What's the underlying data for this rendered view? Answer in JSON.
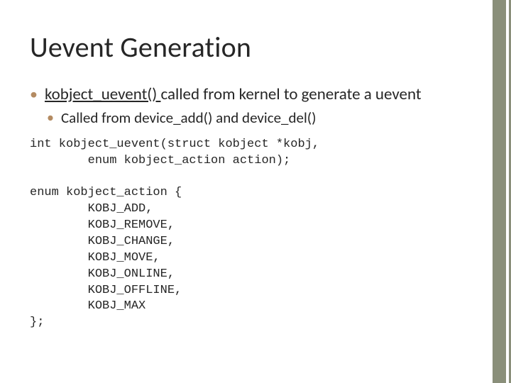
{
  "title": "Uevent Generation",
  "bullet": {
    "link_text": "kobject_uevent() ",
    "rest_text": "called from kernel to generate a uevent"
  },
  "sub_bullet": "Called from device_add() and device_del()",
  "code1": "int kobject_uevent(struct kobject *kobj,\n        enum kobject_action action);",
  "code2": "enum kobject_action {\n        KOBJ_ADD,\n        KOBJ_REMOVE,\n        KOBJ_CHANGE,\n        KOBJ_MOVE,\n        KOBJ_ONLINE,\n        KOBJ_OFFLINE,\n        KOBJ_MAX\n};"
}
